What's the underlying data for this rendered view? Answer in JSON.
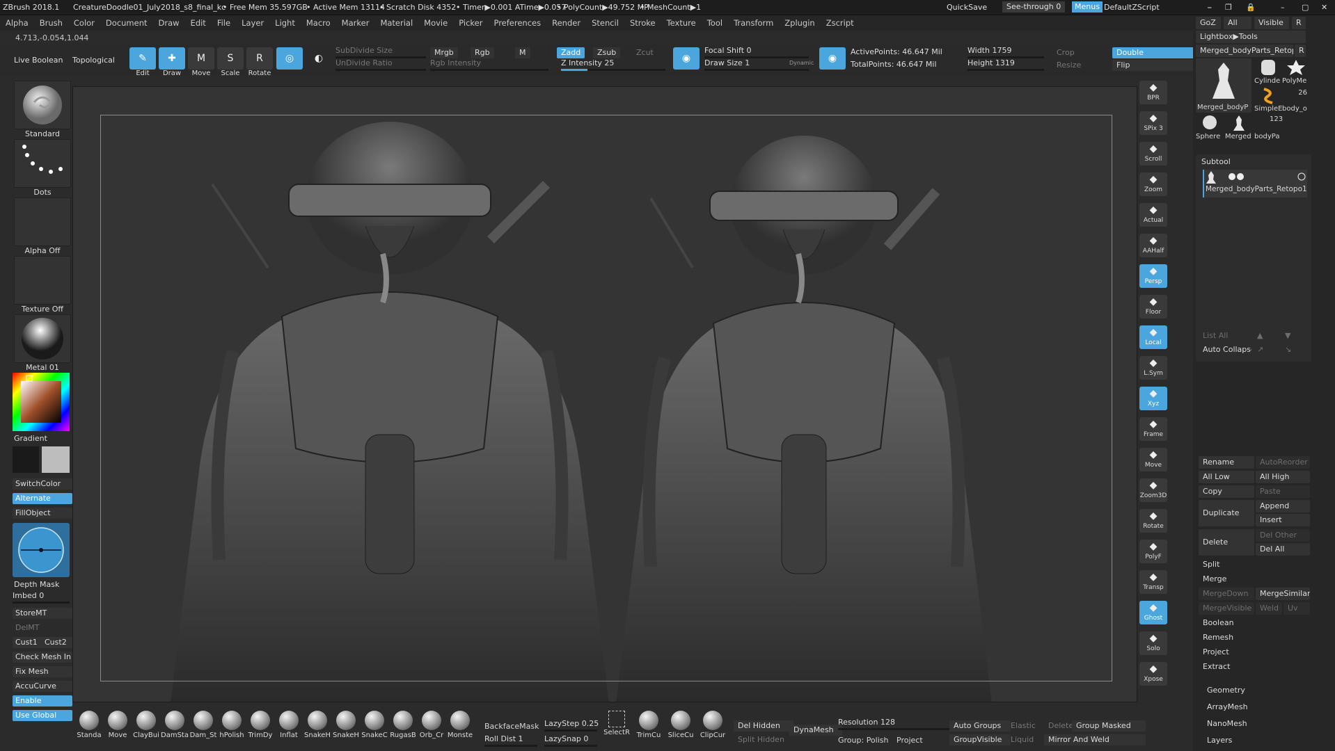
{
  "titlebar": {
    "app": "ZBrush 2018.1",
    "document": "CreatureDoodle01_July2018_s8_final_kc",
    "free_mem": "• Free Mem 35.597GB",
    "active_mem": "• Active Mem 13114",
    "scratch": "• Scratch Disk 4352",
    "timer": "• Timer▶0.001 ATime▶0.057",
    "polycount": "• PolyCount▶49.752 MP",
    "meshcount": "• MeshCount▶1",
    "quicksave": "QuickSave",
    "seethrough": "See-through  0",
    "menus": "Menus",
    "defaultzscript": "DefaultZScript"
  },
  "menubar": [
    "Alpha",
    "Brush",
    "Color",
    "Document",
    "Draw",
    "Edit",
    "File",
    "Layer",
    "Light",
    "Macro",
    "Marker",
    "Material",
    "Movie",
    "Picker",
    "Preferences",
    "Render",
    "Stencil",
    "Stroke",
    "Texture",
    "Tool",
    "Transform",
    "Zplugin",
    "Zscript"
  ],
  "coords": "4.713,-0.054,1.044",
  "topshelf": {
    "live_boolean": "Live Boolean",
    "topological": "Topological",
    "edit": "Edit",
    "draw": "Draw",
    "move": "Move",
    "scale": "Scale",
    "rotate": "Rotate",
    "subdivide_size": "SubDivide Size",
    "undivide_ratio": "UnDivide Ratio",
    "mrgb": "Mrgb",
    "rgb": "Rgb",
    "m": "M",
    "rgb_intensity": "Rgb Intensity",
    "zadd": "Zadd",
    "zsub": "Zsub",
    "zcut": "Zcut",
    "z_intensity": "Z Intensity 25",
    "focal_shift": "Focal Shift 0",
    "draw_size": "Draw Size 1",
    "dynamic": "Dynamic",
    "active_points": "ActivePoints: 46.647 Mil",
    "total_points": "TotalPoints: 46.647 Mil",
    "width": "Width 1759",
    "height": "Height 1319",
    "crop": "Crop",
    "resize": "Resize",
    "double": "Double",
    "flip": "Flip",
    "z_intensity_level": 0.25
  },
  "leftshelf": {
    "brush": "Standard",
    "stroke": "Dots",
    "alpha": "Alpha Off",
    "texture": "Texture Off",
    "material": "Metal 01",
    "gradient": "Gradient",
    "switchcolor": "SwitchColor",
    "alternate": "Alternate",
    "fillobject": "FillObject",
    "depth_mask": "Depth Mask",
    "imbed": "Imbed 0",
    "storemt": "StoreMT",
    "delmt": "DelMT",
    "cust1": "Cust1",
    "cust2": "Cust2",
    "check_mesh": "Check Mesh In",
    "fix_mesh": "Fix Mesh",
    "accucurve": "AccuCurve",
    "enable": "Enable",
    "use_global": "Use Global"
  },
  "rightshelf": [
    {
      "label": "BPR",
      "icon": "bpr-icon"
    },
    {
      "label": "SPix 3",
      "icon": "spix-icon"
    },
    {
      "label": "Scroll",
      "icon": "scroll-icon"
    },
    {
      "label": "Zoom",
      "icon": "zoom-icon"
    },
    {
      "label": "Actual",
      "icon": "actual-icon"
    },
    {
      "label": "AAHalf",
      "icon": "aahalf-icon"
    },
    {
      "label": "Persp",
      "icon": "persp-icon"
    },
    {
      "label": "Floor",
      "icon": "floor-icon"
    },
    {
      "label": "Local",
      "icon": "local-icon"
    },
    {
      "label": "L.Sym",
      "icon": "lsym-icon"
    },
    {
      "label": "Xyz",
      "icon": "xyz-icon"
    },
    {
      "label": "Frame",
      "icon": "frame-icon"
    },
    {
      "label": "Move",
      "icon": "move-icon"
    },
    {
      "label": "Zoom3D",
      "icon": "zoom3d-icon"
    },
    {
      "label": "Rotate",
      "icon": "rotate-icon"
    },
    {
      "label": "PolyF",
      "icon": "polyf-icon"
    },
    {
      "label": "Transp",
      "icon": "transp-icon"
    },
    {
      "label": "Ghost",
      "icon": "ghost-icon"
    },
    {
      "label": "Solo",
      "icon": "solo-icon"
    },
    {
      "label": "Xpose",
      "icon": "xpose-icon"
    }
  ],
  "panel": {
    "goz": "GoZ",
    "all": "All",
    "visible": "Visible",
    "r": "R",
    "lightbox_tools": "Lightbox▶Tools",
    "current_tool": "Merged_bodyParts_Retopo",
    "tools": [
      {
        "label": "Merged_bodyP"
      },
      {
        "label": "Cylinde"
      },
      {
        "label": "PolyMe"
      },
      {
        "label": "SimpleE"
      },
      {
        "label": "body_o"
      },
      {
        "label": "Sphere"
      },
      {
        "label": "Merged"
      },
      {
        "label": "bodyPa"
      }
    ],
    "tool_count_26": "26",
    "tool_count_123": "123",
    "subtool_header": "Subtool",
    "subtool_item": "Merged_bodyParts_Retopo1",
    "list_all": "List All",
    "auto_collapse": "Auto Collapse",
    "rename": "Rename",
    "autoreorder": "AutoReorder",
    "all_low": "All Low",
    "all_high": "All High",
    "copy": "Copy",
    "paste": "Paste",
    "duplicate": "Duplicate",
    "append": "Append",
    "insert": "Insert",
    "delete": "Delete",
    "del_other": "Del Other",
    "del_all": "Del All",
    "split": "Split",
    "merge": "Merge",
    "mergedown": "MergeDown",
    "mergesimilar": "MergeSimilar",
    "mergevisible": "MergeVisible",
    "weld": "Weld",
    "uv": "Uv",
    "boolean": "Boolean",
    "remesh": "Remesh",
    "project": "Project",
    "extract": "Extract",
    "geometry": "Geometry",
    "arraymesh": "ArrayMesh",
    "nanomesh": "NanoMesh",
    "layers": "Layers"
  },
  "bottomshelf": {
    "brushes": [
      "Standa",
      "Move",
      "ClayBui",
      "DamSta",
      "Dam_St",
      "hPolish",
      "TrimDy",
      "Inflat",
      "SnakeH",
      "SnakeH",
      "SnakeC",
      "RugasB",
      "Orb_Cr",
      "Monste"
    ],
    "backfacemask": "BackfaceMask",
    "roll_dist": "Roll Dist 1",
    "lazystep": "LazyStep 0.25",
    "lazysnap": "LazySnap 0",
    "selectr": "SelectR",
    "trimcu": "TrimCu",
    "slicecu": "SliceCu",
    "clipcur": "ClipCur",
    "del_hidden": "Del Hidden",
    "split_hidden": "Split Hidden",
    "dynamesh": "DynaMesh",
    "resolution": "Resolution 128",
    "group_polish": "Group: Polish",
    "project": "Project",
    "auto_groups": "Auto Groups",
    "elastic": "Elastic",
    "delete": "Delete",
    "group_masked": "Group Masked",
    "groupvisible": "GroupVisible",
    "liquid": "Liquid",
    "mirror_weld": "Mirror And Weld"
  },
  "colors": {
    "accent": "#4aa6dc",
    "bg": "#2b2b2b",
    "canvas": "#343434"
  }
}
